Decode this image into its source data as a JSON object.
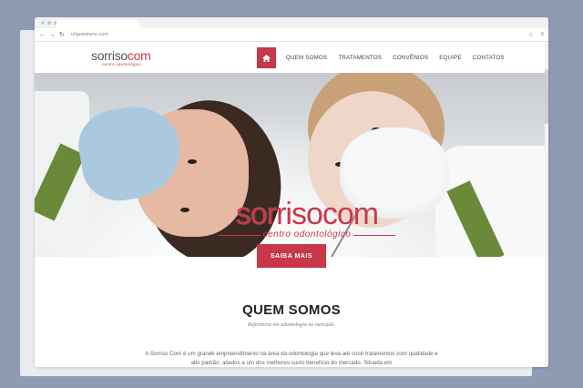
{
  "browser": {
    "url": "urlgoeshere.com",
    "back_icon": "back-arrow-icon",
    "forward_icon": "forward-arrow-icon",
    "reload_icon": "reload-icon",
    "star_icon": "star-icon",
    "menu_icon": "menu-icon"
  },
  "header": {
    "logo_part1": "sorriso",
    "logo_part2": "com",
    "logo_tagline": "centro odontológico",
    "nav": [
      {
        "label": "QUEM SOMOS"
      },
      {
        "label": "TRATAMENTOS"
      },
      {
        "label": "CONVÊNIOS"
      },
      {
        "label": "EQUIPE"
      },
      {
        "label": "CONTATOS"
      }
    ],
    "home_icon": "home-icon"
  },
  "hero": {
    "logo_part1": "sorriso",
    "logo_part2": "com",
    "logo_tagline": "centro odontológico",
    "cta_label": "SAIBA MAIS"
  },
  "about": {
    "title": "QUEM SOMOS",
    "subtitle": "Referência em odontologia no mercado.",
    "body": "A Sorriso Com é um grande empreendimento na área da odontologia que leva até você tratamentos com qualidade e alto padrão, aliados a um dos melhores custo benefício do mercado. Situada em"
  },
  "colors": {
    "accent": "#c8384a",
    "background": "#8f9bb3"
  }
}
